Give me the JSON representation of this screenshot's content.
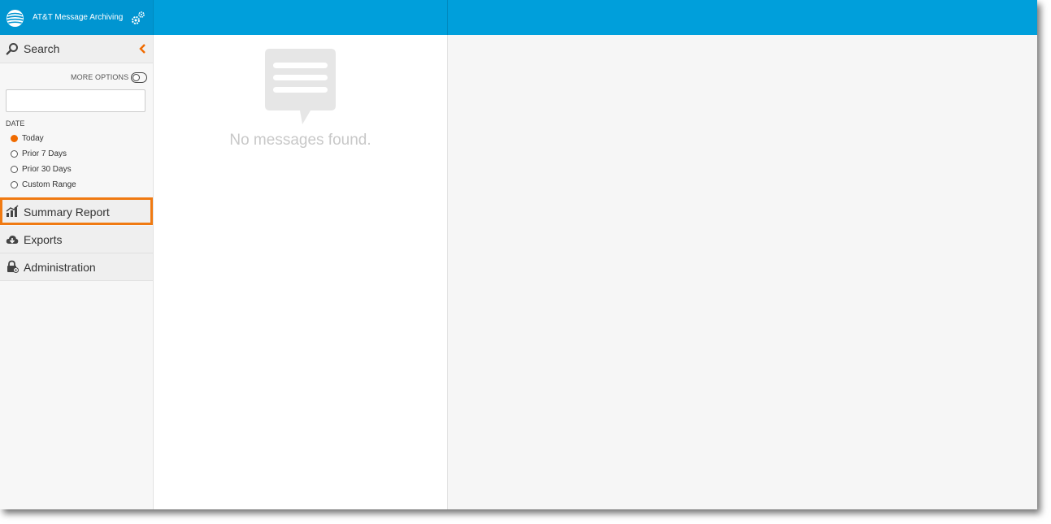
{
  "header": {
    "app_title": "AT&T Message Archiving"
  },
  "sidebar": {
    "search": {
      "label": "Search"
    },
    "more_options_label": "MORE OPTIONS",
    "search_input": {
      "value": "",
      "placeholder": ""
    },
    "date": {
      "label": "DATE",
      "options": [
        {
          "label": "Today",
          "selected": true
        },
        {
          "label": "Prior 7 Days",
          "selected": false
        },
        {
          "label": "Prior 30 Days",
          "selected": false
        },
        {
          "label": "Custom Range",
          "selected": false
        }
      ]
    },
    "nav": [
      {
        "label": "Summary Report",
        "icon": "bar-chart-icon",
        "highlighted": true
      },
      {
        "label": "Exports",
        "icon": "cloud-download-icon",
        "highlighted": false
      },
      {
        "label": "Administration",
        "icon": "lock-icon",
        "highlighted": false
      }
    ]
  },
  "messages": {
    "empty_text": "No messages found."
  },
  "colors": {
    "topbar": "#009fdb",
    "accent": "#f06b00",
    "highlight_border": "#f07a12"
  }
}
